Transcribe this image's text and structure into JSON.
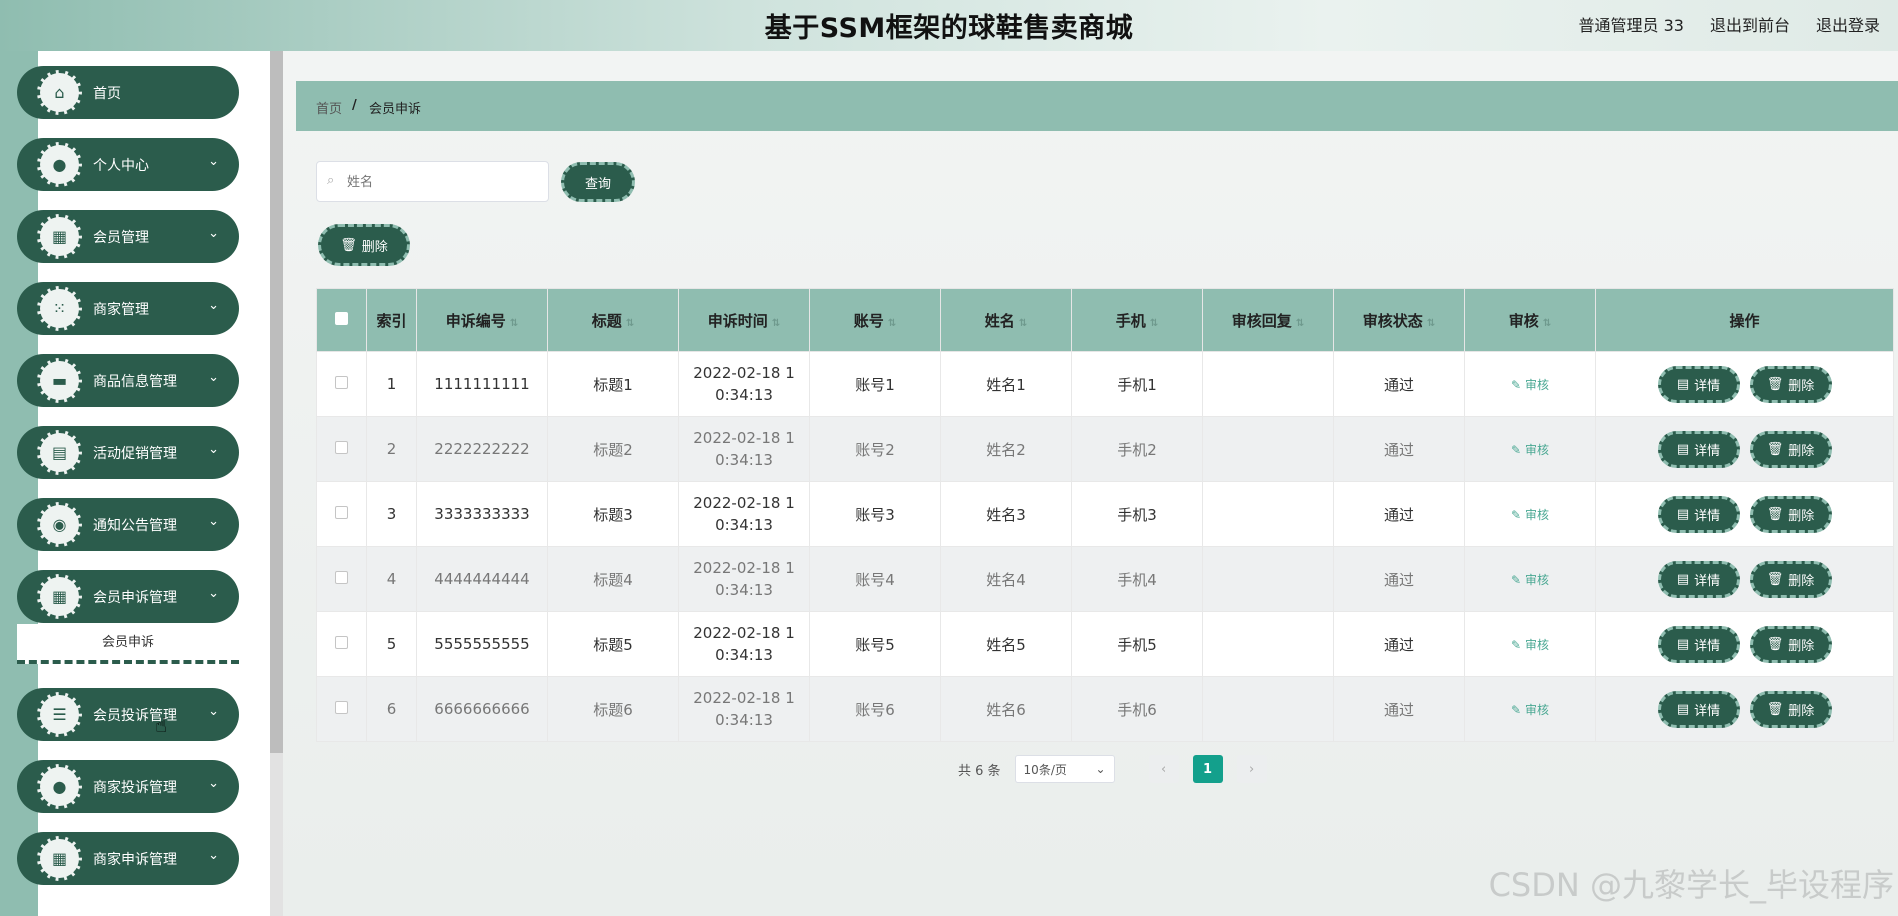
{
  "header": {
    "title": "基于SSM框架的球鞋售卖商城",
    "user": "普通管理员 33",
    "to_front": "退出到前台",
    "logout": "退出登录"
  },
  "sidebar": {
    "items": [
      {
        "label": "首页",
        "icon": "home-icon",
        "glyph": "⌂",
        "expandable": false
      },
      {
        "label": "个人中心",
        "icon": "user-icon",
        "glyph": "●",
        "expandable": true
      },
      {
        "label": "会员管理",
        "icon": "grid-icon",
        "glyph": "▦",
        "expandable": true
      },
      {
        "label": "商家管理",
        "icon": "apps-icon",
        "glyph": "⁙",
        "expandable": true
      },
      {
        "label": "商品信息管理",
        "icon": "monitor-icon",
        "glyph": "▬",
        "expandable": true
      },
      {
        "label": "活动促销管理",
        "icon": "clipboard-icon",
        "glyph": "▤",
        "expandable": true
      },
      {
        "label": "通知公告管理",
        "icon": "location-icon",
        "glyph": "◉",
        "expandable": true
      },
      {
        "label": "会员申诉管理",
        "icon": "grid-icon",
        "glyph": "▦",
        "expandable": true
      },
      {
        "label": "会员投诉管理",
        "icon": "list-icon",
        "glyph": "☰",
        "expandable": true
      },
      {
        "label": "商家投诉管理",
        "icon": "user-icon",
        "glyph": "●",
        "expandable": true
      },
      {
        "label": "商家申诉管理",
        "icon": "grid-icon",
        "glyph": "▦",
        "expandable": true
      }
    ],
    "submenu_label": "会员申诉"
  },
  "breadcrumb": {
    "home": "首页",
    "separator": "/",
    "current": "会员申诉"
  },
  "search": {
    "placeholder": "姓名",
    "query_label": "查询"
  },
  "toolbar": {
    "delete_label": "删除"
  },
  "table": {
    "headers": {
      "index": "索引",
      "code": "申诉编号",
      "title": "标题",
      "time": "申诉时间",
      "account": "账号",
      "name": "姓名",
      "phone": "手机",
      "reply": "审核回复",
      "status": "审核状态",
      "audit": "审核",
      "actions": "操作"
    },
    "audit_label": "审核",
    "detail_label": "详情",
    "delete_label": "删除",
    "rows": [
      {
        "index": "1",
        "code": "1111111111",
        "title": "标题1",
        "time": "2022-02-18 1 0:34:13",
        "account": "账号1",
        "name": "姓名1",
        "phone": "手机1",
        "reply": "",
        "status": "通过"
      },
      {
        "index": "2",
        "code": "2222222222",
        "title": "标题2",
        "time": "2022-02-18 1 0:34:13",
        "account": "账号2",
        "name": "姓名2",
        "phone": "手机2",
        "reply": "",
        "status": "通过"
      },
      {
        "index": "3",
        "code": "3333333333",
        "title": "标题3",
        "time": "2022-02-18 1 0:34:13",
        "account": "账号3",
        "name": "姓名3",
        "phone": "手机3",
        "reply": "",
        "status": "通过"
      },
      {
        "index": "4",
        "code": "4444444444",
        "title": "标题4",
        "time": "2022-02-18 1 0:34:13",
        "account": "账号4",
        "name": "姓名4",
        "phone": "手机4",
        "reply": "",
        "status": "通过"
      },
      {
        "index": "5",
        "code": "5555555555",
        "title": "标题5",
        "time": "2022-02-18 1 0:34:13",
        "account": "账号5",
        "name": "姓名5",
        "phone": "手机5",
        "reply": "",
        "status": "通过"
      },
      {
        "index": "6",
        "code": "6666666666",
        "title": "标题6",
        "time": "2022-02-18 1 0:34:13",
        "account": "账号6",
        "name": "姓名6",
        "phone": "手机6",
        "reply": "",
        "status": "通过"
      }
    ]
  },
  "pagination": {
    "total": "共 6 条",
    "page_size": "10条/页",
    "current_page": "1",
    "prev": "‹",
    "next": "›"
  },
  "watermark": "CSDN @九黎学长_毕设程序",
  "colors": {
    "primary": "#2b5c4c",
    "accent": "#8fbdb0",
    "active_page": "#13a08c"
  }
}
